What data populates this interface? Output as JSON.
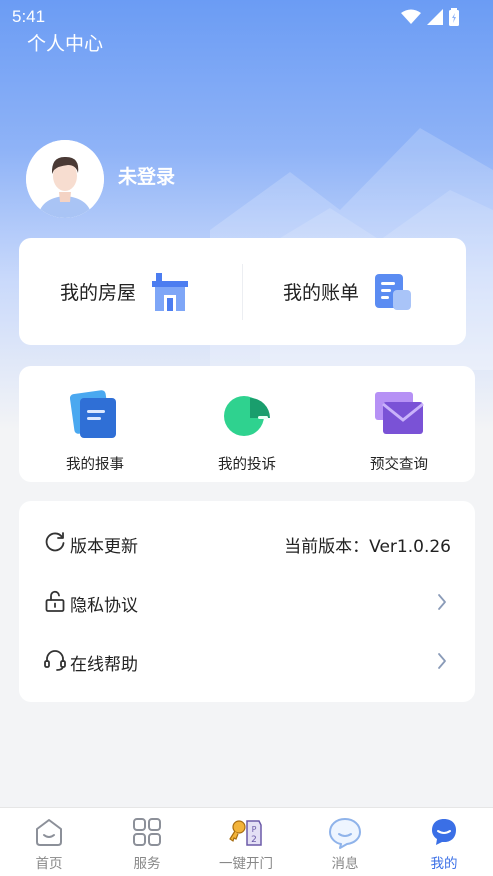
{
  "status_bar": {
    "time": "5:41"
  },
  "header": {
    "title": "个人中心"
  },
  "profile": {
    "username": "未登录"
  },
  "house_card": {
    "my_house": "我的房屋",
    "my_bill": "我的账单"
  },
  "actions": [
    {
      "label": "我的报事",
      "icon": "report-icon"
    },
    {
      "label": "我的投诉",
      "icon": "complaint-icon"
    },
    {
      "label": "预交查询",
      "icon": "prepay-icon"
    }
  ],
  "settings": {
    "update_label": "版本更新",
    "current_version": "当前版本：Ver1.0.26",
    "privacy_label": "隐私协议",
    "help_label": "在线帮助"
  },
  "tabbar": {
    "active": "我的",
    "items": [
      {
        "label": "首页",
        "icon": "home-icon"
      },
      {
        "label": "服务",
        "icon": "services-grid-icon"
      },
      {
        "label": "一键开门",
        "icon": "keys-icon"
      },
      {
        "label": "消息",
        "icon": "message-bubble-icon"
      },
      {
        "label": "我的",
        "icon": "profile-icon"
      }
    ]
  },
  "colors": {
    "accent": "#3a6fe6",
    "hero_top": "#6b9cf4",
    "background": "#f3f4f6"
  }
}
